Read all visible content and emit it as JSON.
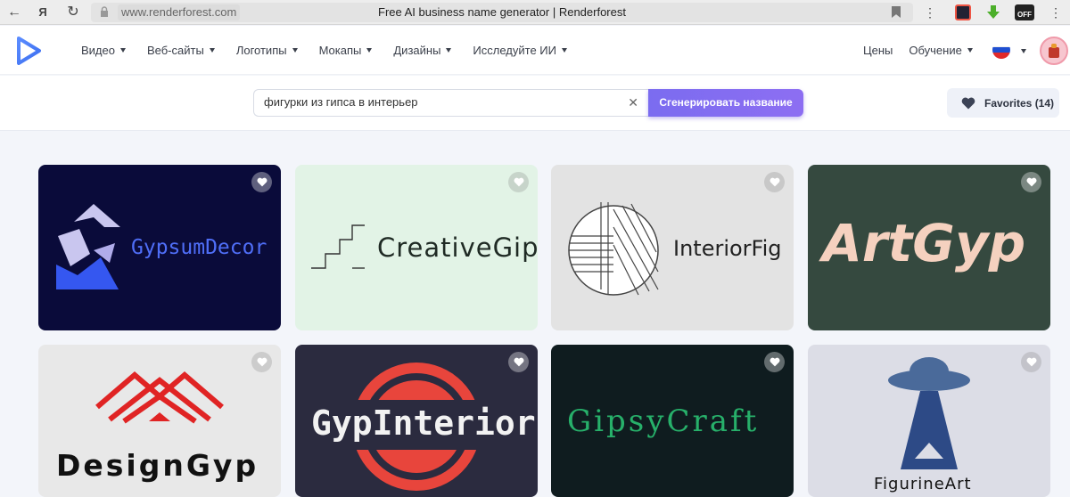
{
  "browser": {
    "url": "www.renderforest.com",
    "tab_title": "Free AI business name generator | Renderforest"
  },
  "header": {
    "menu": [
      "Видео",
      "Веб-сайты",
      "Логотипы",
      "Мокапы",
      "Дизайны",
      "Исследуйте ИИ"
    ],
    "pricing": "Цены",
    "learning": "Обучение"
  },
  "search": {
    "value": "фигурки из гипса в интерьер",
    "generate_label": "Сгенерировать название",
    "favorites_label": "Favorites (14)"
  },
  "cards": [
    {
      "name": "GypsumDecor",
      "bg": "#0a0b3a",
      "text_color": "#4f6ef7"
    },
    {
      "name": "CreativeGips",
      "bg": "#e2f3e6",
      "text_color": "#1f2a24"
    },
    {
      "name": "InteriorFig",
      "bg": "#e3e3e3",
      "text_color": "#222222"
    },
    {
      "name": "ArtGyp",
      "bg": "#35493f",
      "text_color": "#f5d1bf"
    },
    {
      "name": "DesignGyp",
      "bg": "#e8e8e8",
      "text_color": "#111111"
    },
    {
      "name": "GypInteriors",
      "bg": "#2b2b3f",
      "text_color": "#f2f2f2"
    },
    {
      "name": "GipsyCraft",
      "bg": "#0f1c1f",
      "text_color": "#27b06a"
    },
    {
      "name": "FigurineArt",
      "bg": "#dcdde6",
      "text_color": "#111111"
    }
  ],
  "icons": {
    "card_favorite": "heart-icon",
    "clear": "close-icon",
    "favorites": "heart-icon"
  }
}
